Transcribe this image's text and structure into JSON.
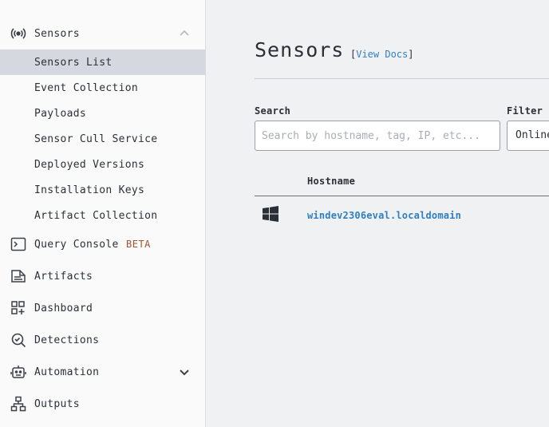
{
  "sidebar": {
    "sensors": {
      "label": "Sensors",
      "icon": "broadcast-icon"
    },
    "sub_items": [
      {
        "label": "Sensors List",
        "active": true
      },
      {
        "label": "Event Collection"
      },
      {
        "label": "Payloads"
      },
      {
        "label": "Sensor Cull Service"
      },
      {
        "label": "Deployed Versions"
      },
      {
        "label": "Installation Keys"
      },
      {
        "label": "Artifact Collection"
      }
    ],
    "query_console": {
      "label": "Query Console",
      "badge": "BETA"
    },
    "artifacts": {
      "label": "Artifacts"
    },
    "dashboard": {
      "label": "Dashboard"
    },
    "detections": {
      "label": "Detections"
    },
    "automation": {
      "label": "Automation"
    },
    "outputs": {
      "label": "Outputs"
    }
  },
  "main": {
    "title": "Sensors",
    "docs_open": "[",
    "docs_link": "View Docs",
    "docs_close": "]",
    "search": {
      "label": "Search",
      "placeholder": "Search by hostname, tag, IP, etc..."
    },
    "filter": {
      "label": "Filter",
      "value": "Online"
    },
    "table": {
      "headers": {
        "hostname": "Hostname"
      },
      "rows": [
        {
          "os_icon": "windows-icon",
          "hostname": "windev2306eval.localdomain"
        }
      ]
    }
  },
  "colors": {
    "accent": "#2f7fc1",
    "beta": "#a0522d",
    "active_bg": "#d5d8de"
  }
}
